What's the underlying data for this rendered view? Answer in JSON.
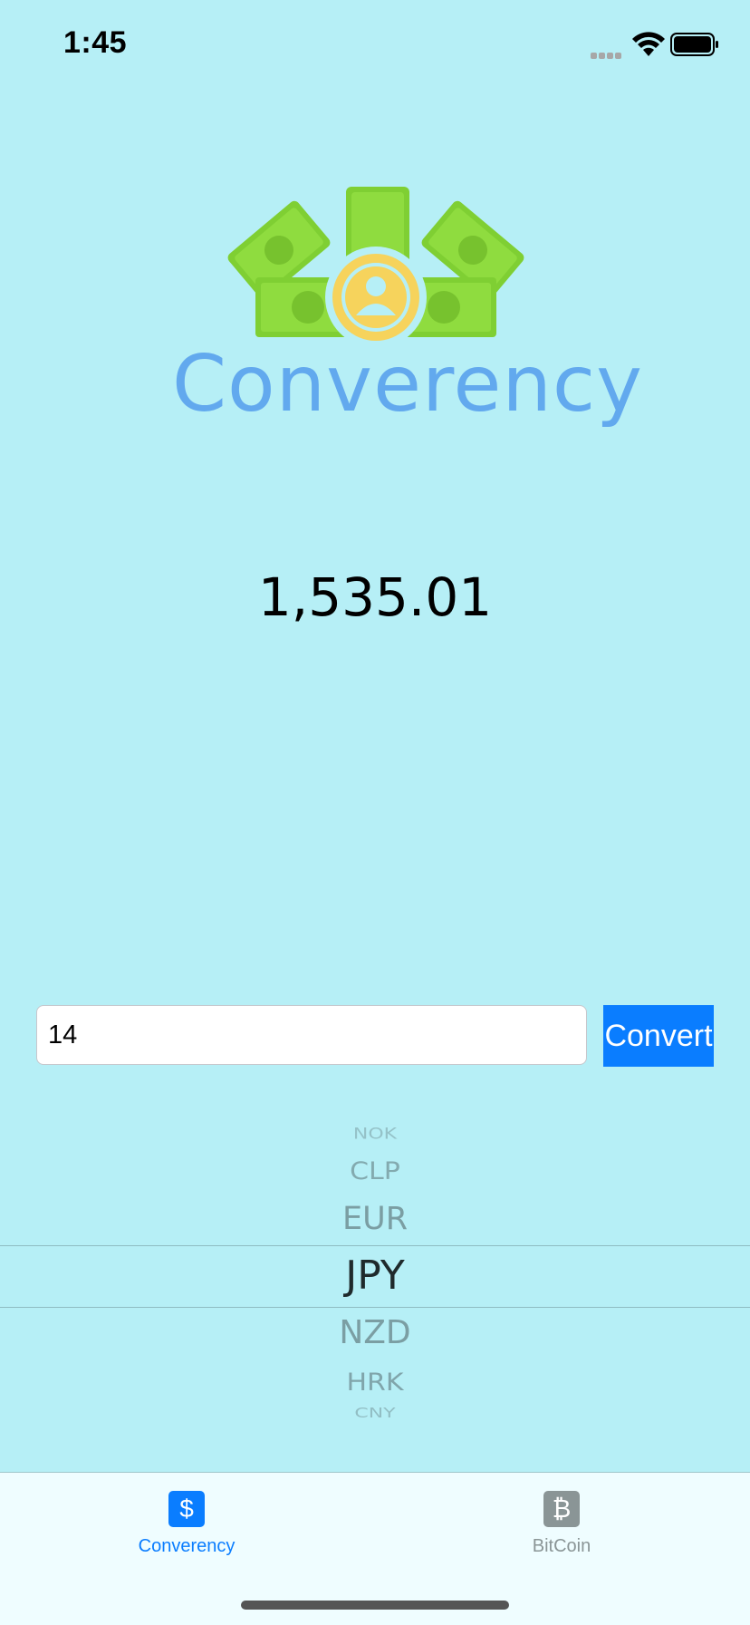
{
  "status_bar": {
    "time": "1:45",
    "signal_icon": "cellular-signal-icon",
    "wifi_icon": "wifi-icon",
    "battery_icon": "battery-icon"
  },
  "logo": {
    "text": "Converency",
    "icon": "money-stack-icon",
    "colors": {
      "money": "#8fdc3f",
      "coin": "#f6d35c",
      "text": "#62a9ee"
    }
  },
  "result": {
    "value": "1,535.01"
  },
  "amount_input": {
    "value": "14"
  },
  "convert_button": {
    "label": "Convert",
    "color": "#0a7dff"
  },
  "currency_picker": {
    "items_above": [
      "NOK",
      "CLP",
      "EUR"
    ],
    "selected": "JPY",
    "items_below": [
      "NZD",
      "HRK",
      "CNY"
    ]
  },
  "tab_bar": {
    "tabs": [
      {
        "label": "Converency",
        "icon": "dollar-icon",
        "icon_glyph": "$",
        "active": true,
        "color": "#0a7dff"
      },
      {
        "label": "BitCoin",
        "icon": "bitcoin-icon",
        "icon_glyph": "₿",
        "active": false,
        "color": "#8a9596"
      }
    ]
  }
}
